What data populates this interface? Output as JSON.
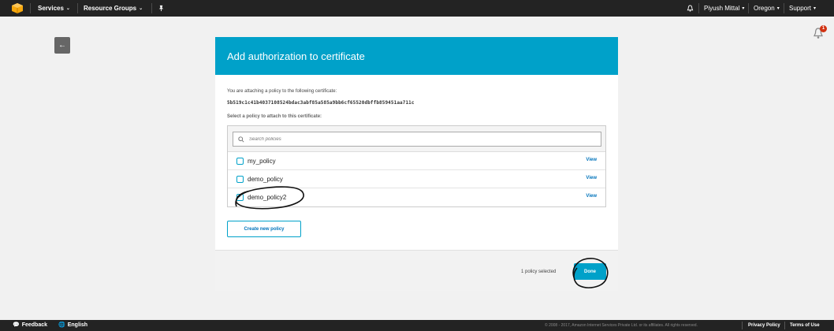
{
  "topnav": {
    "services": "Services",
    "resource_groups": "Resource Groups",
    "user": "Piyush Mittal",
    "region": "Oregon",
    "support": "Support",
    "icons": [
      "aws-logo-icon",
      "pin-icon",
      "bell-icon"
    ]
  },
  "notifications": {
    "count": "1"
  },
  "dialog": {
    "title": "Add authorization to certificate",
    "intro": "You are attaching a policy to the following certificate:",
    "certificate_id": "5b519c1c41b4037108524bdac3abf85a585a9bb6cf65520dbffb859451aa711c",
    "select_label": "Select a policy to attach to this certificate:",
    "search_placeholder": "Search policies",
    "policies": [
      {
        "name": "my_policy",
        "checked": false,
        "view": "View"
      },
      {
        "name": "demo_policy",
        "checked": false,
        "view": "View"
      },
      {
        "name": "demo_policy2",
        "checked": true,
        "view": "View"
      }
    ],
    "create_button": "Create new policy",
    "selected_count": "1 policy selected",
    "done_button": "Done"
  },
  "footer": {
    "feedback": "Feedback",
    "language": "English",
    "copyright": "© 2008 - 2017, Amazon Internet Services Private Ltd. or its affiliates. All rights reserved.",
    "privacy": "Privacy Policy",
    "terms": "Terms of Use"
  },
  "colors": {
    "accent": "#00a1c9",
    "nav": "#232323",
    "link": "#0073bb",
    "badge": "#d13212"
  }
}
